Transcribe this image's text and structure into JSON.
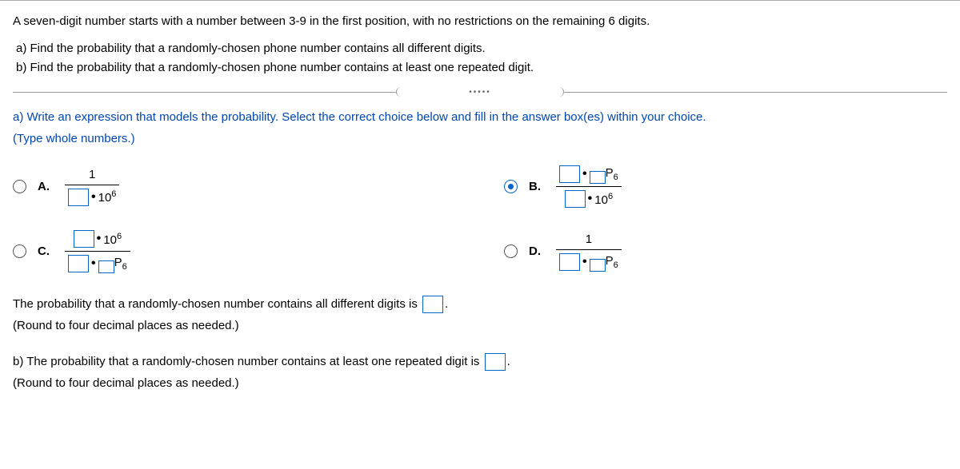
{
  "question": {
    "intro": "A seven-digit number starts with a number between 3-9 in the first position, with no restrictions on the remaining 6 digits.",
    "part_a": "a) Find the probability that a randomly-chosen phone number contains all different digits.",
    "part_b": "b) Find the probability that a randomly-chosen phone number contains at least one repeated digit."
  },
  "instruction": {
    "line1": "a) Write an expression that models the probability. Select the correct choice below and fill in the answer box(es) within your choice.",
    "line2": "(Type whole numbers.)"
  },
  "choices": {
    "A": {
      "label": "A.",
      "numer_text": "1",
      "denom_ten6": "10",
      "denom_exp": "6"
    },
    "B": {
      "label": "B.",
      "psub_sym": "P",
      "psub_val": "6",
      "ten": "10",
      "exp": "6"
    },
    "C": {
      "label": "C.",
      "ten": "10",
      "exp": "6",
      "psub_sym": "P",
      "psub_val": "6"
    },
    "D": {
      "label": "D.",
      "numer_text": "1",
      "psub_sym": "P",
      "psub_val": "6"
    }
  },
  "selected_choice": "B",
  "followups": {
    "a_text1": "The probability that a randomly-chosen number contains all different digits is ",
    "a_text2": ".",
    "a_hint": "(Round to four decimal places as needed.)",
    "b_text1": "b) The probability that a randomly-chosen number contains at least one repeated digit is ",
    "b_text2": ".",
    "b_hint": "(Round to four decimal places as needed.)"
  }
}
